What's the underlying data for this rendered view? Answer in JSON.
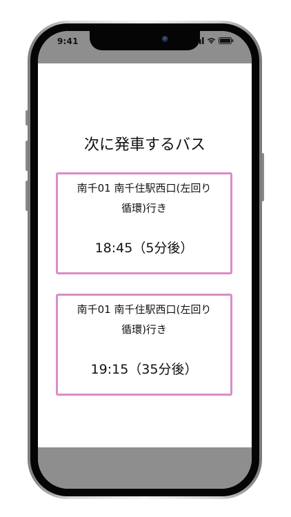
{
  "status_bar": {
    "time": "9:41"
  },
  "page": {
    "title": "次に発車するバス"
  },
  "buses": [
    {
      "route_line1": "南千01 南千住駅西口(左回り",
      "route_line2": "循環)行き",
      "departure": "18:45（5分後）"
    },
    {
      "route_line1": "南千01 南千住駅西口(左回り",
      "route_line2": "循環)行き",
      "departure": "19:15（35分後）"
    }
  ],
  "theme": {
    "card_border": "#d98cc4",
    "bar_color": "#8e8e8e"
  },
  "icons": [
    "signal-icon",
    "wifi-icon",
    "battery-icon",
    "camera-icon"
  ]
}
